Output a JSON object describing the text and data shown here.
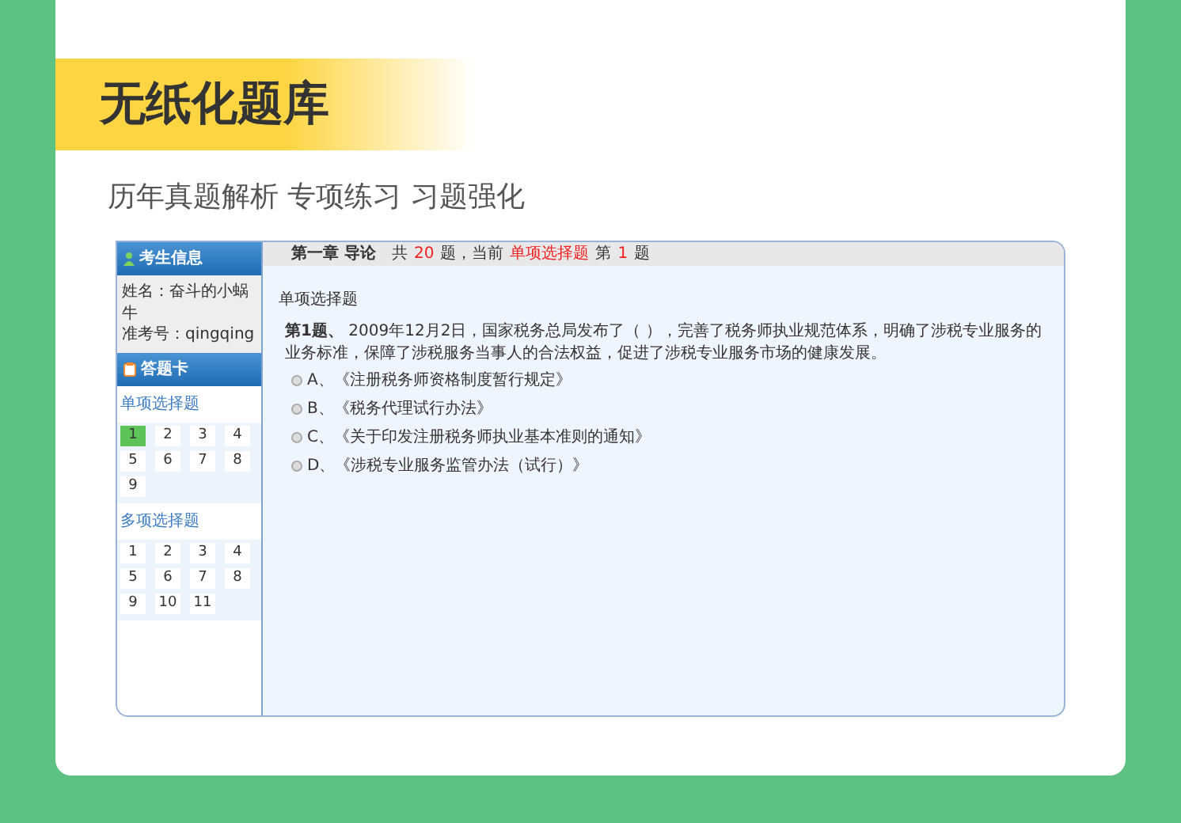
{
  "banner": {
    "title": "无纸化题库"
  },
  "subtitle": "历年真题解析 专项练习 习题强化",
  "exam": {
    "sidebar": {
      "info_title": "考生信息",
      "info_lines": [
        "姓名：奋斗的小蜗牛",
        "准考号：qingqing"
      ],
      "card_title": "答题卡",
      "sections": [
        {
          "title": "单项选择题",
          "numbers": [
            {
              "label": "1",
              "selected": true
            },
            {
              "label": "2",
              "selected": false
            },
            {
              "label": "3",
              "selected": false
            },
            {
              "label": "4",
              "selected": false
            },
            {
              "label": "5",
              "selected": false
            },
            {
              "label": "6",
              "selected": false
            },
            {
              "label": "7",
              "selected": false
            },
            {
              "label": "8",
              "selected": false
            },
            {
              "label": "9",
              "selected": false
            }
          ]
        },
        {
          "title": "多项选择题",
          "numbers": [
            {
              "label": "1",
              "selected": false
            },
            {
              "label": "2",
              "selected": false
            },
            {
              "label": "3",
              "selected": false
            },
            {
              "label": "4",
              "selected": false
            },
            {
              "label": "5",
              "selected": false
            },
            {
              "label": "6",
              "selected": false
            },
            {
              "label": "7",
              "selected": false
            },
            {
              "label": "8",
              "selected": false
            },
            {
              "label": "9",
              "selected": false
            },
            {
              "label": "10",
              "selected": false
            },
            {
              "label": "11",
              "selected": false
            }
          ]
        }
      ]
    },
    "header": {
      "chapter": "第一章 导论",
      "segments": [
        {
          "text": "共",
          "highlight": false
        },
        {
          "text": "20",
          "highlight": true
        },
        {
          "text": "题，当前",
          "highlight": false
        },
        {
          "text": "单项选择题",
          "highlight": true
        },
        {
          "text": "第",
          "highlight": false
        },
        {
          "text": "1",
          "highlight": true
        },
        {
          "text": "题",
          "highlight": false
        }
      ]
    },
    "question": {
      "type": "单项选择题",
      "number": "第1题、",
      "text": "2009年12月2日，国家税务总局发布了（ ），完善了税务师执业规范体系，明确了涉税专业服务的业务标准，保障了涉税服务当事人的合法权益，促进了涉税专业服务市场的健康发展。",
      "options": [
        {
          "label": "A、《注册税务师资格制度暂行规定》",
          "checked": false
        },
        {
          "label": "B、《税务代理试行办法》",
          "checked": false
        },
        {
          "label": "C、《关于印发注册税务师执业基本准则的通知》",
          "checked": false
        },
        {
          "label": "D、《涉税专业服务监管办法（试行）》",
          "checked": false
        }
      ]
    }
  }
}
